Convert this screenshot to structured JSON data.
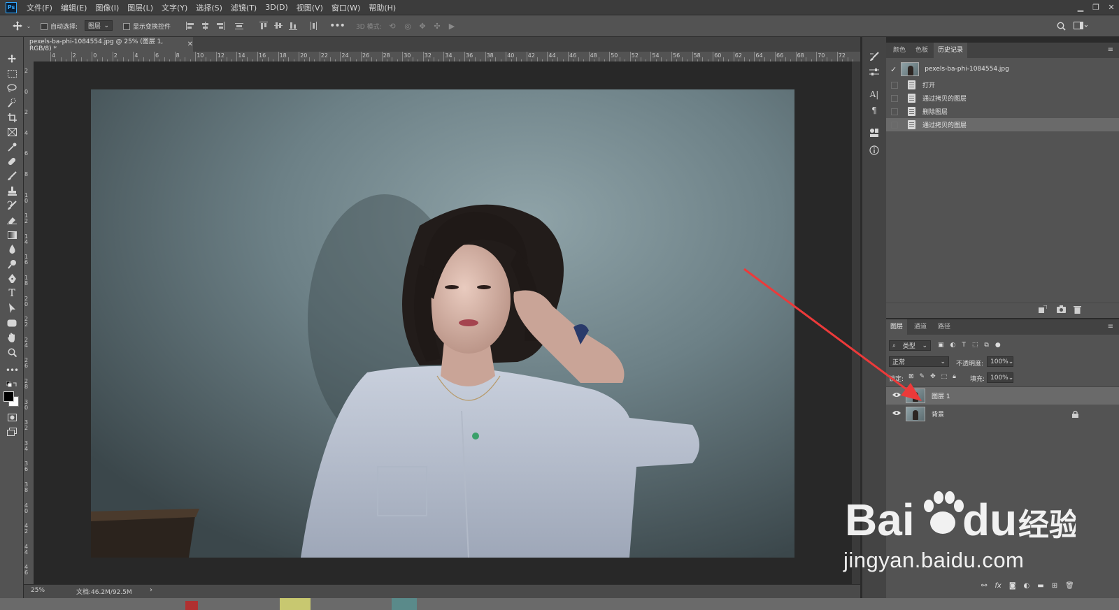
{
  "app": {
    "logo": "Ps"
  },
  "menu": [
    "文件(F)",
    "编辑(E)",
    "图像(I)",
    "图层(L)",
    "文字(Y)",
    "选择(S)",
    "滤镜(T)",
    "3D(D)",
    "视图(V)",
    "窗口(W)",
    "帮助(H)"
  ],
  "options": {
    "auto_select_label": "自动选择:",
    "auto_select_value": "图层",
    "show_transform_label": "显示变换控件",
    "mode_3d_label": "3D 模式:"
  },
  "document": {
    "tab_title": "pexels-ba-phi-1084554.jpg @ 25% (图层 1, RGB/8) *",
    "zoom": "25%",
    "file_info": "文档:46.2M/92.5M"
  },
  "ruler": {
    "h_labels": [
      "4",
      "2",
      "0",
      "2",
      "4",
      "6",
      "8",
      "10",
      "12",
      "14",
      "16",
      "18",
      "20",
      "22",
      "24",
      "26",
      "28",
      "30",
      "32",
      "34",
      "36",
      "38",
      "40",
      "42",
      "44",
      "46",
      "48",
      "50",
      "52",
      "54",
      "56",
      "58",
      "60",
      "62",
      "64",
      "66",
      "68",
      "70",
      "72"
    ],
    "v_labels": [
      "2",
      "0",
      "2",
      "4",
      "6",
      "8",
      "10",
      "12",
      "14",
      "16",
      "18",
      "20",
      "22",
      "24",
      "26",
      "28",
      "30",
      "32",
      "34",
      "36",
      "38",
      "40",
      "42",
      "44",
      "46"
    ]
  },
  "top_panel": {
    "tabs": [
      "颜色",
      "色板",
      "历史记录"
    ],
    "active_tab": 2,
    "snapshot_name": "pexels-ba-phi-1084554.jpg",
    "history": [
      "打开",
      "通过拷贝的图层",
      "删除图层",
      "通过拷贝的图层"
    ],
    "selected_history": 3
  },
  "layers_panel": {
    "tabs": [
      "图层",
      "通道",
      "路径"
    ],
    "filter_kind": "类型",
    "blend_mode": "正常",
    "opacity_label": "不透明度:",
    "opacity_value": "100%",
    "lock_label": "锁定:",
    "fill_label": "填充:",
    "fill_value": "100%",
    "layers": [
      {
        "name": "图层 1",
        "selected": true,
        "locked": false
      },
      {
        "name": "背景",
        "selected": false,
        "locked": true
      }
    ]
  },
  "watermark": {
    "brand": "Bai",
    "brand2": "du",
    "cn": "经验",
    "url": "jingyan.baidu.com"
  },
  "colors": {
    "menubar": "#3c3c3c",
    "panel": "#535353",
    "canvas": "#282828",
    "arrow": "#ec3a3a"
  }
}
